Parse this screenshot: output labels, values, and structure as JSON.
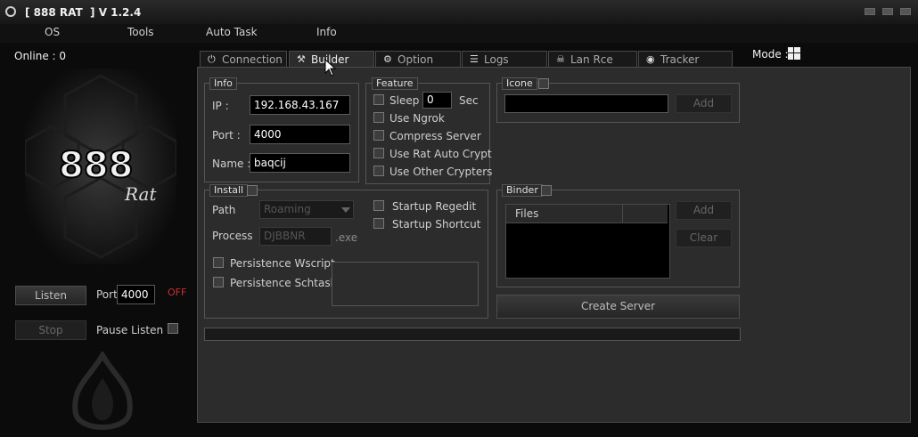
{
  "window": {
    "title": "[ 888 RAT  ] V 1.2.4"
  },
  "menu": [
    "OS",
    "Tools",
    "Auto Task",
    "Info"
  ],
  "sidebar": {
    "online_label": "Online : 0",
    "listen_label": "Listen",
    "port_label": "Port",
    "port_value": "4000",
    "port_status": "OFF",
    "stop_label": "Stop",
    "pause_label": "Pause Listen"
  },
  "tabs": [
    {
      "label": "Connection",
      "icon": "plug-icon"
    },
    {
      "label": "Builder",
      "icon": "tools-icon"
    },
    {
      "label": "Option",
      "icon": "gear-icon"
    },
    {
      "label": "Logs",
      "icon": "document-icon"
    },
    {
      "label": "Lan Rce",
      "icon": "skull-icon"
    },
    {
      "label": "Tracker",
      "icon": "globe-icon"
    }
  ],
  "mode": {
    "label": "Mode :",
    "icon": "windows-icon"
  },
  "builder": {
    "info": {
      "title": "Info",
      "ip_label": "IP :",
      "ip_value": "192.168.43.167",
      "port_label": "Port :",
      "port_value": "4000",
      "name_label": "Name :",
      "name_value": "baqcij"
    },
    "feature": {
      "title": "Feature",
      "sleep_label": "Sleep",
      "sleep_value": "0",
      "sleep_unit": "Sec",
      "ngrok_label": "Use Ngrok",
      "compress_label": "Compress Server",
      "autocrypt_label": "Use Rat Auto Crypt",
      "crypters_label": "Use Other Crypters"
    },
    "icone": {
      "title": "Icone",
      "add_label": "Add"
    },
    "install": {
      "title": "Install",
      "path_label": "Path",
      "path_value": "Roaming",
      "process_label": "Process",
      "process_value": "DJBBNR",
      "process_ext": ".exe",
      "regedit_label": "Startup Regedit",
      "shortcut_label": "Startup Shortcut",
      "wscript_label": "Persistence Wscript",
      "schtasks_label": "Persistence Schtasks"
    },
    "binder": {
      "title": "Binder",
      "files_header": "Files",
      "add_label": "Add",
      "clear_label": "Clear"
    },
    "create_server_label": "Create Server"
  },
  "logo": {
    "text": "888",
    "subtext": "Rat"
  },
  "colors": {
    "accent_off": "#c83030",
    "panel": "#2c2c2c",
    "background": "#0b0b0b"
  }
}
